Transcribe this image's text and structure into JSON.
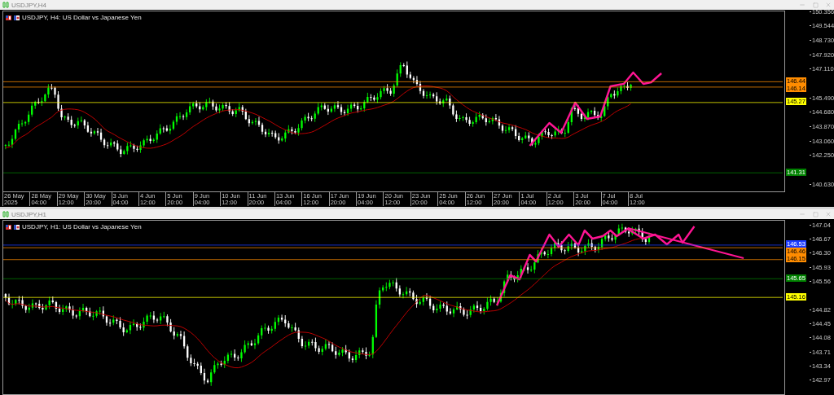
{
  "windows": [
    {
      "title": "USDJPY,H4",
      "legend": "USDJPY, H4:  US Dollar vs Japanese Yen",
      "price_ticks": [
        "150.356",
        "149.544",
        "148.730",
        "147.920",
        "147.110",
        "145.490",
        "144.680",
        "143.870",
        "143.060",
        "142.250",
        "140.630"
      ],
      "price_tags": [
        {
          "text": "146.44",
          "color": "#ff8c00"
        },
        {
          "text": "146.14",
          "color": "#ff8c00"
        },
        {
          "text": "145.27",
          "color": "#ffff00"
        },
        {
          "text": "141.31",
          "color": "#008000"
        }
      ],
      "time_ticks": [
        "26 May 2025",
        "28 May 04:00",
        "29 May 12:00",
        "30 May 20:00",
        "3 Jun 04:00",
        "4 Jun 12:00",
        "5 Jun 20:00",
        "9 Jun 04:00",
        "10 Jun 12:00",
        "11 Jun 20:00",
        "13 Jun 04:00",
        "16 Jun 12:00",
        "17 Jun 20:00",
        "19 Jun 04:00",
        "20 Jun 12:00",
        "23 Jun 20:00",
        "25 Jun 04:00",
        "26 Jun 12:00",
        "27 Jun 20:00",
        "1 Jul 04:00",
        "2 Jul 12:00",
        "3 Jul 20:00",
        "7 Jul 04:00",
        "8 Jul 12:00"
      ]
    },
    {
      "title": "USDJPY,H1",
      "legend": "USDJPY, H1:  US Dollar vs Japanese Yen",
      "price_ticks": [
        "147.04",
        "146.67",
        "146.30",
        "145.93",
        "145.56",
        "144.82",
        "144.45",
        "144.08",
        "143.71",
        "143.34",
        "142.97"
      ],
      "price_tags": [
        {
          "text": "146.53",
          "color": "#1e3cff"
        },
        {
          "text": "146.46",
          "color": "#ff8c00"
        },
        {
          "text": "146.15",
          "color": "#ff8c00"
        },
        {
          "text": "145.65",
          "color": "#008000"
        },
        {
          "text": "145.16",
          "color": "#ffff00"
        }
      ]
    }
  ]
}
